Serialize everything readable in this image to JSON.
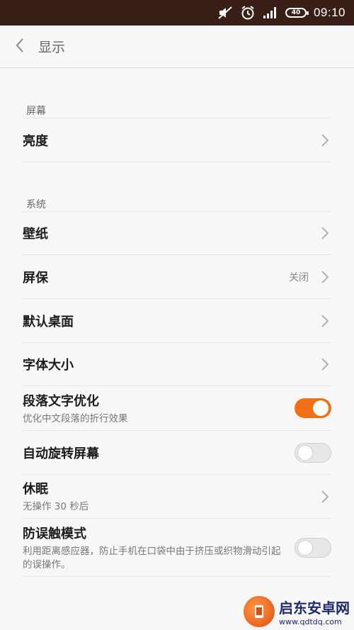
{
  "status_bar": {
    "time": "09:10",
    "battery_label": "40",
    "icons": [
      "mute-icon",
      "alarm-icon",
      "signal-icon",
      "battery-icon"
    ]
  },
  "header": {
    "title": "显示",
    "back_icon": "chevron-left-icon"
  },
  "sections": {
    "screen": {
      "label": "屏幕",
      "items": {
        "brightness": {
          "title": "亮度"
        }
      }
    },
    "system": {
      "label": "系统",
      "items": {
        "wallpaper": {
          "title": "壁纸"
        },
        "screensaver": {
          "title": "屏保",
          "value": "关闭"
        },
        "default_launcher": {
          "title": "默认桌面"
        },
        "font_size": {
          "title": "字体大小"
        },
        "paragraph_opt": {
          "title": "段落文字优化",
          "subtitle": "优化中文段落的折行效果",
          "enabled": true
        },
        "auto_rotate": {
          "title": "自动旋转屏幕",
          "enabled": false
        },
        "sleep": {
          "title": "休眠",
          "subtitle": "无操作 30 秒后"
        },
        "anti_mistouch": {
          "title": "防误触模式",
          "subtitle": "利用距离感应器，防止手机在口袋中由于挤压或织物滑动引起的误操作。",
          "enabled": false
        }
      }
    }
  },
  "colors": {
    "status_bar_bg": "#3a1f17",
    "accent": "#f36f17",
    "background": "#f7f7f7"
  },
  "watermark": {
    "name": "启东安卓网",
    "url": "www.qdtdq.com"
  }
}
